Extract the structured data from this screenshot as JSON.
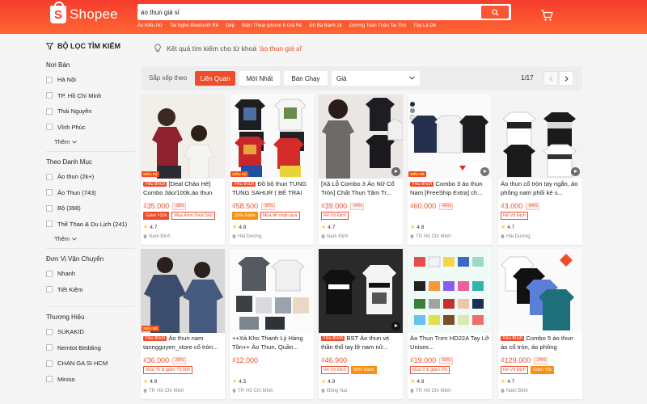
{
  "header": {
    "brand": "Shopee",
    "search_value": "áo thun giá sỉ",
    "suggestions": [
      "Áo Kiểu Nữ",
      "Tai Nghe Bluetooth Rẻ",
      "Dép",
      "Điện Thoại Iphone 6 Giá Rẻ",
      "Đồ Bà Bành 1k",
      "Gương Toàn Thân Tai Thỏ",
      "Tỏa Lá Dẻ"
    ]
  },
  "sidebar": {
    "filter_title": "BỘ LỌC TÌM KIẾM",
    "sections": [
      {
        "heading": "Nơi Bán",
        "options": [
          "Hà Nội",
          "TP. Hồ Chí Minh",
          "Thái Nguyên",
          "Vĩnh Phúc"
        ],
        "more": "Thêm"
      },
      {
        "heading": "Theo Danh Mục",
        "options": [
          "Áo thun (2k+)",
          "Áo Thun (743)",
          "Bộ (398)",
          "Thể Thao & Du Lịch (241)"
        ],
        "more": "Thêm"
      },
      {
        "heading": "Đơn Vị Vận Chuyển",
        "options": [
          "Nhanh",
          "Tiết Kiệm"
        ]
      },
      {
        "heading": "Thương Hiệu",
        "options": [
          "SUKAKID",
          "Nemtot Bedding",
          "CHAN GA SI HCM",
          "Miniso"
        ]
      }
    ]
  },
  "result": {
    "prefix": "Kết quả tìm kiếm cho từ khoá",
    "keyword": "'áo thun giá sỉ'"
  },
  "sortbar": {
    "label": "Sắp xếp theo",
    "options": [
      "Liên Quan",
      "Mới Nhất",
      "Bán Chạy"
    ],
    "active": "Liên Quan",
    "price_label": "Giá",
    "page": "1/17"
  },
  "colors": {
    "brand": "#ee4d2d",
    "header": "#f53d2d",
    "rating": "#ffce3d"
  },
  "products": [
    {
      "fav": "Yêu thích",
      "name": "[Deal Chảo Hè] Combo 3áo/100k,áo thun",
      "price": "₫35.000",
      "discount": "-38%",
      "tags": [
        "Giảm ₫10k",
        "Mua Kèm Deal Sốc"
      ],
      "rating": "4.7",
      "location": "Nam Định",
      "overlay": "SIÊU RẺ"
    },
    {
      "fav": "Yêu thích",
      "name": "Đồ bộ thun TUNG TUNG SAHUR ( BÉ TRAI",
      "price": "₫58.500",
      "discount": "-35%",
      "tags": [
        "25% Giảm",
        "Mua để nhận quà"
      ],
      "rating": "4.8",
      "location": "Hải Dương",
      "overlay": "SIÊU RẺ"
    },
    {
      "fav": "",
      "name": "[Xả Lỗ Combo 3 Áo Nữ Cổ Tròn] Chất Thun Tăm Tr...",
      "price": "₫39.000",
      "discount": "-24%",
      "tags": [
        "Rẻ Vô Địch"
      ],
      "rating": "4.7",
      "location": "Nam Định",
      "overlay": ""
    },
    {
      "fav": "Yêu thích",
      "name": "Combo 3 áo thun Nam [FreeShip Extra] ch...",
      "price": "₫60.000",
      "discount": "-40%",
      "tags": [],
      "rating": "4.8",
      "location": "TP. Hồ Chí Minh",
      "overlay": "SIÊU RẺ"
    },
    {
      "fav": "",
      "name": "Áo thun cổ tròn tay ngắn, áo phông nam phối kẻ s...",
      "price": "₫3.000",
      "discount": "-84%",
      "tags": [
        "Rẻ Vô Địch"
      ],
      "rating": "4.7",
      "location": "Hải Dương",
      "overlay": ""
    },
    {
      "fav": "Yêu thích",
      "name": "Áo thun nam tanngguyen_store cổ tròn...",
      "price": "₫36.000",
      "discount": "-39%",
      "tags": [
        "Mua ₫5 & giảm ₫3.000"
      ],
      "rating": "4.9",
      "location": "TP. Hồ Chí Minh",
      "overlay": "SIÊU RẺ"
    },
    {
      "fav": "",
      "name": "++Xả Kho Thanh Lý Hàng Tồn++ Áo Thun, Quần...",
      "price": "₫12.000",
      "discount": "",
      "tags": [],
      "rating": "4.5",
      "location": "TP. Hồ Chí Minh",
      "overlay": ""
    },
    {
      "fav": "Yêu thích",
      "name": "BST Áo thun vịt thần thổ tay lỡ nam nữ...",
      "price": "₫46.900",
      "discount": "",
      "tags": [
        "Rẻ Vô Địch",
        "58% Giảm"
      ],
      "rating": "4.9",
      "location": "Đồng Nai",
      "overlay": ""
    },
    {
      "fav": "",
      "name": "Áo Thun Trơn HD22A Tay Lỡ Unisex...",
      "price": "₫19.000",
      "discount": "-60%",
      "tags": [
        "Mua 3 & giảm 2%"
      ],
      "rating": "4.9",
      "location": "TP. Hồ Chí Minh",
      "overlay": ""
    },
    {
      "fav": "Yêu thích",
      "name": "Combo 5 áo thun áo cổ tròn, áo phông",
      "price": "₫129.000",
      "discount": "-24%",
      "tags": [
        "Rẻ Vô Địch",
        "Giảm ₫2k"
      ],
      "rating": "4.7",
      "location": "Nam Định",
      "overlay": ""
    }
  ]
}
